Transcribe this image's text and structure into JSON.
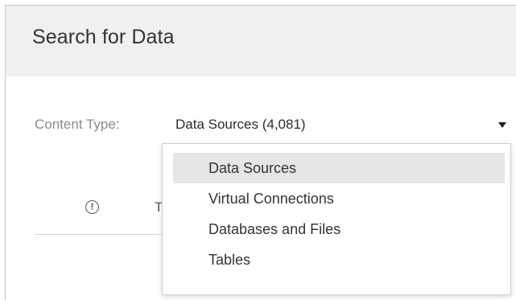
{
  "header": {
    "title": "Search for Data"
  },
  "content_type": {
    "label": "Content Type:",
    "selected_value": "Data Sources (4,081)"
  },
  "table": {
    "info_icon_glyph": "!",
    "column_header_partial": "T"
  },
  "dropdown": {
    "items": [
      {
        "label": "Data Sources",
        "selected": true
      },
      {
        "label": "Virtual Connections",
        "selected": false
      },
      {
        "label": "Databases and Files",
        "selected": false
      },
      {
        "label": "Tables",
        "selected": false
      }
    ]
  },
  "colors": {
    "header_background": "#f0f0f0",
    "selected_item_background": "#e6e6e6"
  }
}
